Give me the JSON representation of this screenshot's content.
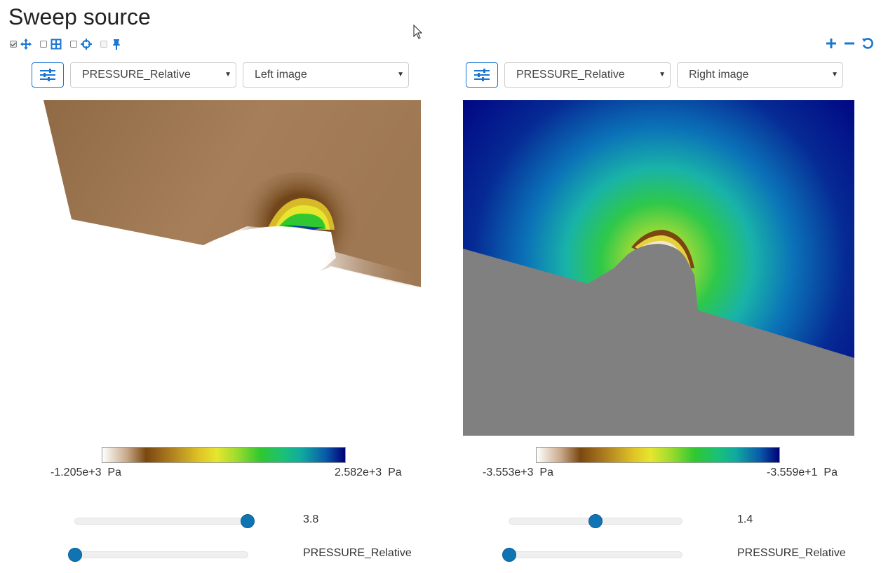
{
  "page": {
    "title": "Sweep source"
  },
  "toolbar": {
    "items": [
      {
        "checked": true,
        "icon": "move-icon"
      },
      {
        "checked": false,
        "icon": "grid-icon"
      },
      {
        "checked": false,
        "icon": "crosshair-icon"
      },
      {
        "checked": false,
        "icon": "pin-icon"
      }
    ],
    "right_icons": [
      "zoom-in-icon",
      "zoom-out-icon",
      "reset-icon"
    ]
  },
  "colors": {
    "accent": "#1976d2",
    "slider": "#0f74b4",
    "surface_gray": "#808080"
  },
  "left": {
    "field": "PRESSURE_Relative",
    "image": "Left image",
    "colorbar": {
      "min": "-1.205e+3",
      "max": "2.582e+3",
      "unit": "Pa"
    },
    "slider1": {
      "value": "3.8",
      "fraction": 1.0
    },
    "slider2": {
      "label": "PRESSURE_Relative",
      "fraction": 0.0
    }
  },
  "right": {
    "field": "PRESSURE_Relative",
    "image": "Right image",
    "colorbar": {
      "min": "-3.553e+3",
      "max": "-3.559e+1",
      "unit": "Pa"
    },
    "slider1": {
      "value": "1.4",
      "fraction": 0.5
    },
    "slider2": {
      "label": "PRESSURE_Relative",
      "fraction": 0.0
    }
  }
}
